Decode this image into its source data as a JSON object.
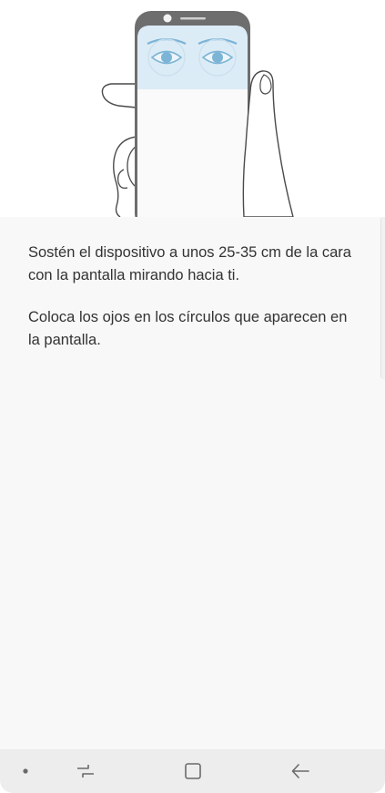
{
  "instructions": {
    "paragraph_1": "Sostén el dispositivo a unos 25-35 cm de la cara con la pantalla mirando hacia ti.",
    "paragraph_2": "Coloca los ojos en los círculos que aparecen en la pantalla."
  },
  "illustration": {
    "subject": "hand-holding-phone-with-eyes-on-screen",
    "colors": {
      "phone_frame": "#6e6e6e",
      "phone_screen_top": "#dcecf6",
      "eyes": "#7cb4d6",
      "outline": "#4a4a4a"
    }
  },
  "navigation_bar": {
    "buttons": [
      "dot",
      "recents",
      "home",
      "back"
    ],
    "icons": {
      "dot": "dot-icon",
      "recents": "recents-icon",
      "home": "home-icon",
      "back": "back-arrow-icon"
    },
    "background": "#ededed",
    "icon_color": "#6a6a6a"
  }
}
